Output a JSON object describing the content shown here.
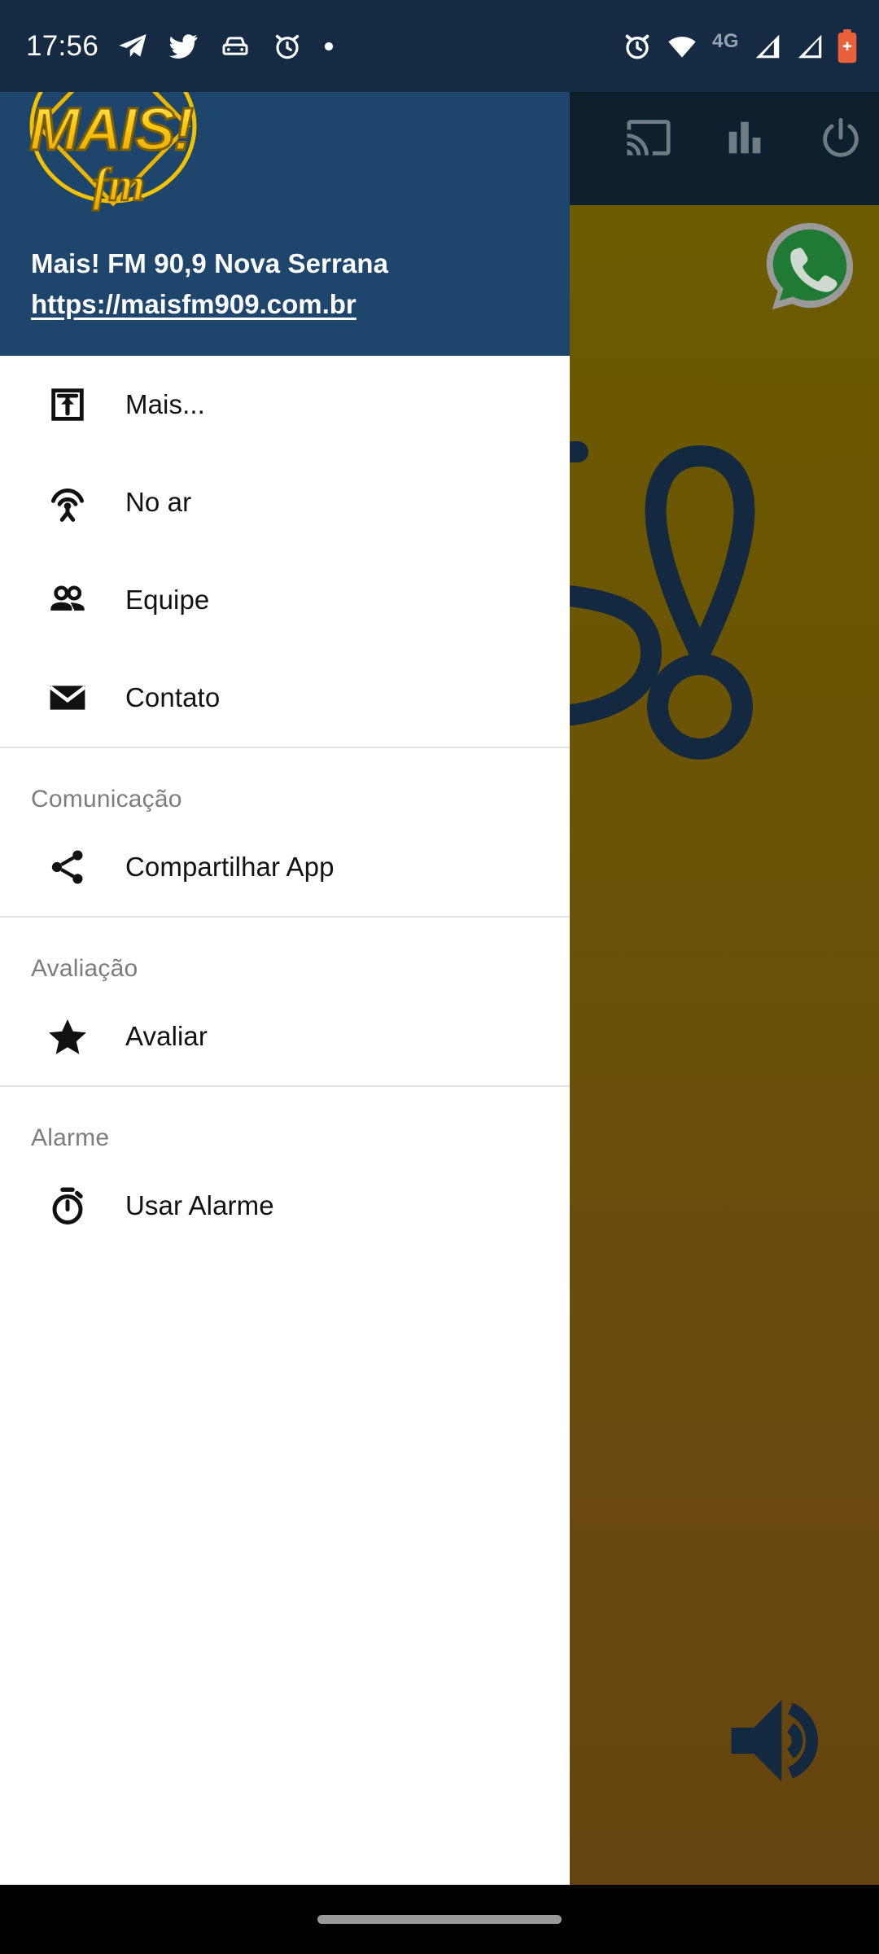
{
  "status_bar": {
    "clock": "17:56",
    "left_icons": [
      "telegram-icon",
      "twitter-icon",
      "car-icon",
      "alarm-icon",
      "dot-icon"
    ],
    "right_icons": [
      "alarm-icon",
      "wifi-icon",
      "signal-icon",
      "signal-icon",
      "battery-icon"
    ],
    "network_label": "4G",
    "colors": {
      "background": "#142b43",
      "foreground": "#ffffff",
      "battery": "#e8613a",
      "muted": "#96a3ae"
    }
  },
  "app_bar": {
    "background": "#0e1f2e",
    "actions": [
      {
        "name": "cast-icon",
        "label": "Transmitir"
      },
      {
        "name": "equalizer-icon",
        "label": "Equalizador"
      },
      {
        "name": "power-icon",
        "label": "Desligar"
      }
    ],
    "icon_color": "#6e7c85"
  },
  "drawer": {
    "background": "#ffffff",
    "header": {
      "background": "#1e456b",
      "logo": {
        "name": "mais-fm-logo",
        "frequency": "90.9",
        "wordmark": "MAIS!",
        "suffix": "fm",
        "primary_color": "#f5c518",
        "accent_color": "#fff28a"
      },
      "title": "Mais! FM 90,9 Nova Serrana",
      "url": "https://maisfm909.com.br"
    },
    "groups": [
      {
        "section": null,
        "items": [
          {
            "icon": "open-in-new-icon",
            "label": "Mais..."
          },
          {
            "icon": "broadcast-icon",
            "label": "No ar"
          },
          {
            "icon": "people-icon",
            "label": "Equipe"
          },
          {
            "icon": "mail-icon",
            "label": "Contato"
          }
        ]
      },
      {
        "section": "Comunicação",
        "items": [
          {
            "icon": "share-icon",
            "label": "Compartilhar App"
          }
        ]
      },
      {
        "section": "Avaliação",
        "items": [
          {
            "icon": "star-icon",
            "label": "Avaliar"
          }
        ]
      },
      {
        "section": "Alarme",
        "items": [
          {
            "icon": "stopwatch-icon",
            "label": "Usar Alarme"
          }
        ]
      }
    ]
  },
  "player": {
    "background_gradient_top": "#6d6100",
    "background_gradient_bottom": "#65440f",
    "watermark": {
      "name": "mais-fm-watermark",
      "color": "#13293f"
    },
    "whatsapp_button": {
      "name": "whatsapp-icon",
      "color": "#1f7a33",
      "outline": "#9a9a9a"
    },
    "volume_button": {
      "name": "volume-icon",
      "color": "#13293f"
    }
  },
  "nav_bar": {
    "background": "#000000",
    "pill_color": "#9a9a9a"
  }
}
